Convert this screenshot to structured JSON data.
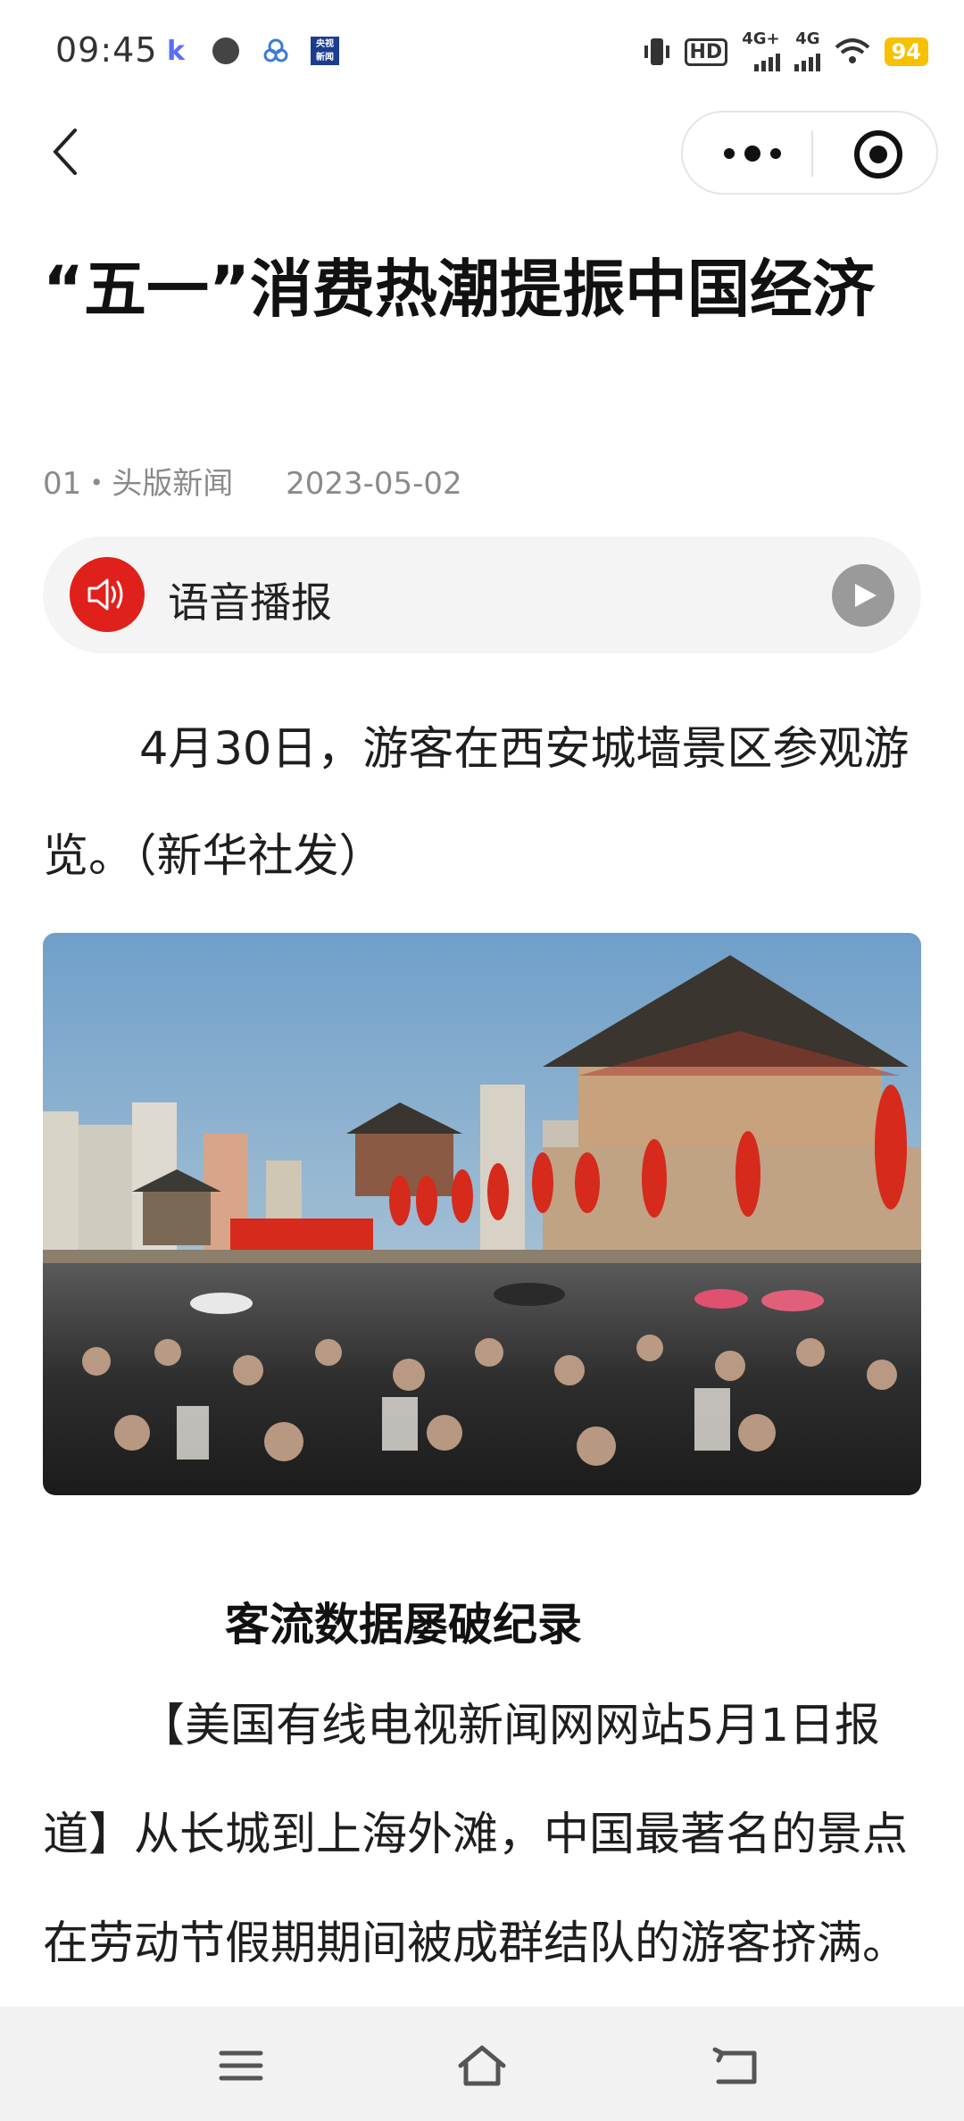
{
  "status_bar": {
    "time": "09:45",
    "notification_icons": [
      "app-k-icon",
      "dial-icon",
      "shapes-icon",
      "cctv-news-icon"
    ],
    "cctv_label": "央视\n新闻",
    "hd_label": "HD",
    "network_1": "4G+",
    "network_2": "4G",
    "battery": "94"
  },
  "nav": {
    "back_icon": "chevron-left-icon",
    "more_icon": "more-dots-icon",
    "close_icon": "target-close-icon"
  },
  "article": {
    "title": "“五一”消费热潮提振中国经济",
    "section": "01・头版新闻",
    "date": "2023-05-02",
    "tts_label": "语音播报",
    "photo_caption": "4月30日，游客在西安城墙景区参观游览。（新华社发）",
    "subheading": "客流数据屡破纪录",
    "paragraph": "【美国有线电视新闻网网站5月1日报道】从长城到上海外滩，中国最著名的景点在劳动节假期期间被成群结队的游客挤满。"
  },
  "system_nav": {
    "menu_icon": "menu-icon",
    "home_icon": "home-icon",
    "back_icon": "back-arrow-icon"
  },
  "colors": {
    "accent_red": "#e0201b",
    "battery_yellow": "#f7c100",
    "meta_gray": "#8a8a8a"
  }
}
